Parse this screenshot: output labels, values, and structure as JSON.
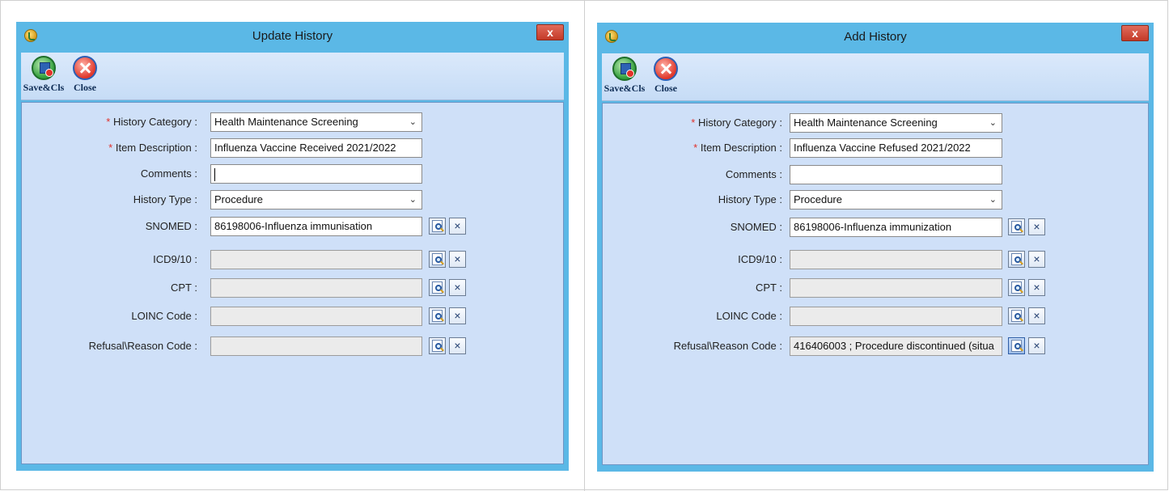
{
  "left_dialog": {
    "title": "Update History",
    "close_glyph": "x",
    "toolbar": {
      "save_label": "Save&Cls",
      "close_label": "Close"
    },
    "labels": {
      "history_category": "History Category :",
      "item_description": "Item Description :",
      "comments": "Comments :",
      "history_type": "History Type :",
      "snomed": "SNOMED :",
      "icd": "ICD9/10 :",
      "cpt": "CPT :",
      "loinc": "LOINC Code :",
      "refusal": "Refusal\\Reason Code :"
    },
    "values": {
      "history_category": "Health Maintenance Screening",
      "item_description": "Influenza Vaccine Received  2021/2022",
      "comments": "",
      "history_type": "Procedure",
      "snomed": "86198006-Influenza immunisation",
      "icd": "",
      "cpt": "",
      "loinc": "",
      "refusal": ""
    }
  },
  "right_dialog": {
    "title": "Add History",
    "close_glyph": "x",
    "toolbar": {
      "save_label": "Save&Cls",
      "close_label": "Close"
    },
    "labels": {
      "history_category": "History Category :",
      "item_description": "Item Description :",
      "comments": "Comments :",
      "history_type": "History Type :",
      "snomed": "SNOMED :",
      "icd": "ICD9/10 :",
      "cpt": "CPT :",
      "loinc": "LOINC Code :",
      "refusal": "Refusal\\Reason Code :"
    },
    "values": {
      "history_category": "Health Maintenance Screening",
      "item_description": "Influenza Vaccine Refused 2021/2022",
      "comments": "",
      "history_type": "Procedure",
      "snomed": "86198006-Influenza immunization",
      "icd": "",
      "cpt": "",
      "loinc": "",
      "refusal": "416406003 ; Procedure discontinued (situa"
    }
  },
  "common": {
    "required_marker": "*",
    "clear_glyph": "×",
    "dropdown_glyph": "⌄"
  },
  "colors": {
    "title_bar": "#5bb8e6",
    "form_bg": "#cfe0f8",
    "required": "#e0302a"
  }
}
